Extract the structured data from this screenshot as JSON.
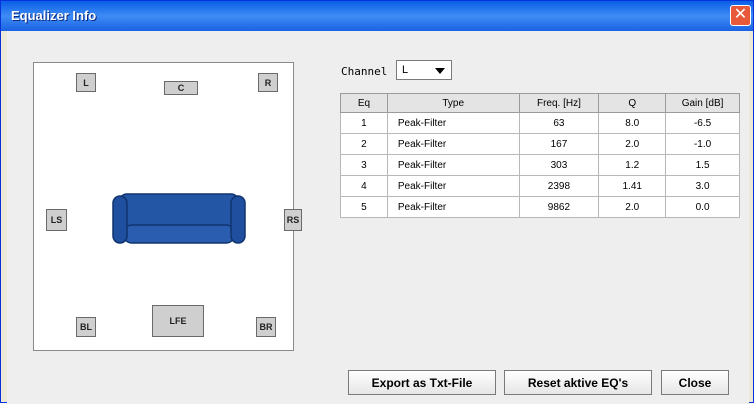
{
  "window": {
    "title": "Equalizer Info",
    "close_glyph": "✕"
  },
  "speakers": {
    "L": "L",
    "C": "C",
    "R": "R",
    "LS": "LS",
    "RS": "RS",
    "BL": "BL",
    "LFE": "LFE",
    "BR": "BR"
  },
  "channel": {
    "label": "Channel",
    "selected": "L"
  },
  "table": {
    "columns": [
      "Eq",
      "Type",
      "Freq. [Hz]",
      "Q",
      "Gain [dB]"
    ],
    "rows": [
      [
        "1",
        "Peak-Filter",
        "63",
        "8.0",
        "-6.5"
      ],
      [
        "2",
        "Peak-Filter",
        "167",
        "2.0",
        "-1.0"
      ],
      [
        "3",
        "Peak-Filter",
        "303",
        "1.2",
        "1.5"
      ],
      [
        "4",
        "Peak-Filter",
        "2398",
        "1.41",
        "3.0"
      ],
      [
        "5",
        "Peak-Filter",
        "9862",
        "2.0",
        "0.0"
      ]
    ]
  },
  "buttons": {
    "export": "Export as Txt-File",
    "reset": "Reset aktive EQ's",
    "close": "Close"
  },
  "colors": {
    "sofa": "#1f4f9e",
    "title_bar": "#0a5fe8"
  }
}
